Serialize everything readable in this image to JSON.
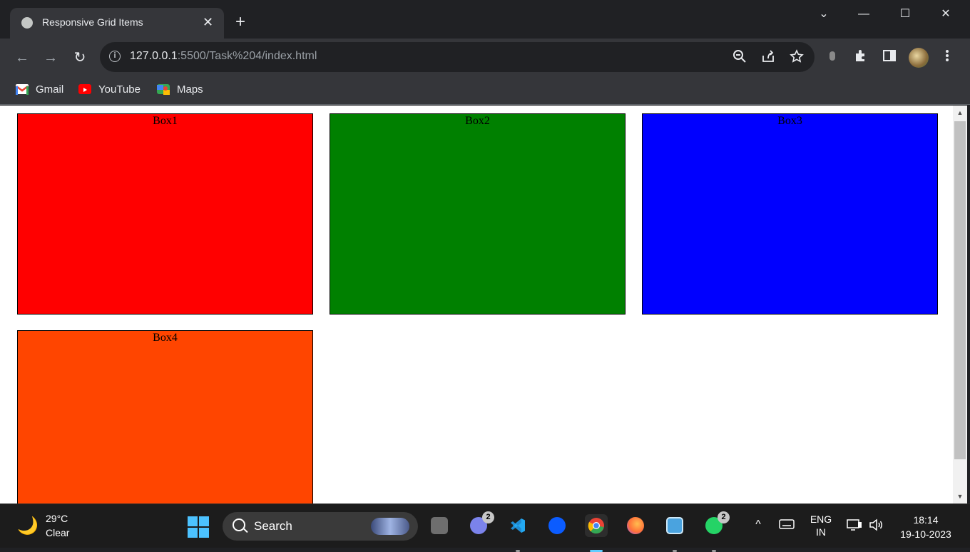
{
  "browser": {
    "tab_title": "Responsive Grid Items",
    "new_tab_label": "+",
    "close_label": "✕",
    "url_host": "127.0.0.1",
    "url_path": ":5500/Task%204/index.html",
    "back_label": "←",
    "forward_label": "→",
    "reload_label": "↻",
    "bookmarks": [
      {
        "label": "Gmail",
        "icon": "gmail-icon",
        "color": "#ea4335"
      },
      {
        "label": "YouTube",
        "icon": "youtube-icon",
        "color": "#ff0000"
      },
      {
        "label": "Maps",
        "icon": "maps-icon",
        "color": "#34a853"
      }
    ],
    "window_controls": {
      "dropdown": "⌄",
      "minimize": "—",
      "maximize": "☐",
      "close": "✕"
    }
  },
  "page": {
    "boxes": [
      {
        "label": "Box1",
        "color": "#ff0000"
      },
      {
        "label": "Box2",
        "color": "#008000"
      },
      {
        "label": "Box3",
        "color": "#0000ff"
      },
      {
        "label": "Box4",
        "color": "#ff4500"
      }
    ]
  },
  "taskbar": {
    "weather": {
      "temp": "29°C",
      "condition": "Clear"
    },
    "search_label": "Search",
    "apps": [
      {
        "name": "task-view-icon",
        "color": "#b0b0b0"
      },
      {
        "name": "teams-icon",
        "color": "#7b83eb",
        "badge": "2"
      },
      {
        "name": "vscode-icon",
        "color": "#23a9f2"
      },
      {
        "name": "zoom-icon",
        "color": "#0b5cff"
      },
      {
        "name": "chrome-icon",
        "color": "#fbbc04"
      },
      {
        "name": "firefox-icon",
        "color": "#ff7139"
      },
      {
        "name": "control-panel-icon",
        "color": "#4aa3df"
      },
      {
        "name": "whatsapp-icon",
        "color": "#25d366",
        "badge": "2"
      }
    ],
    "tray": {
      "chevron": "^",
      "language_top": "ENG",
      "language_bottom": "IN",
      "time": "18:14",
      "date": "19-10-2023"
    }
  }
}
